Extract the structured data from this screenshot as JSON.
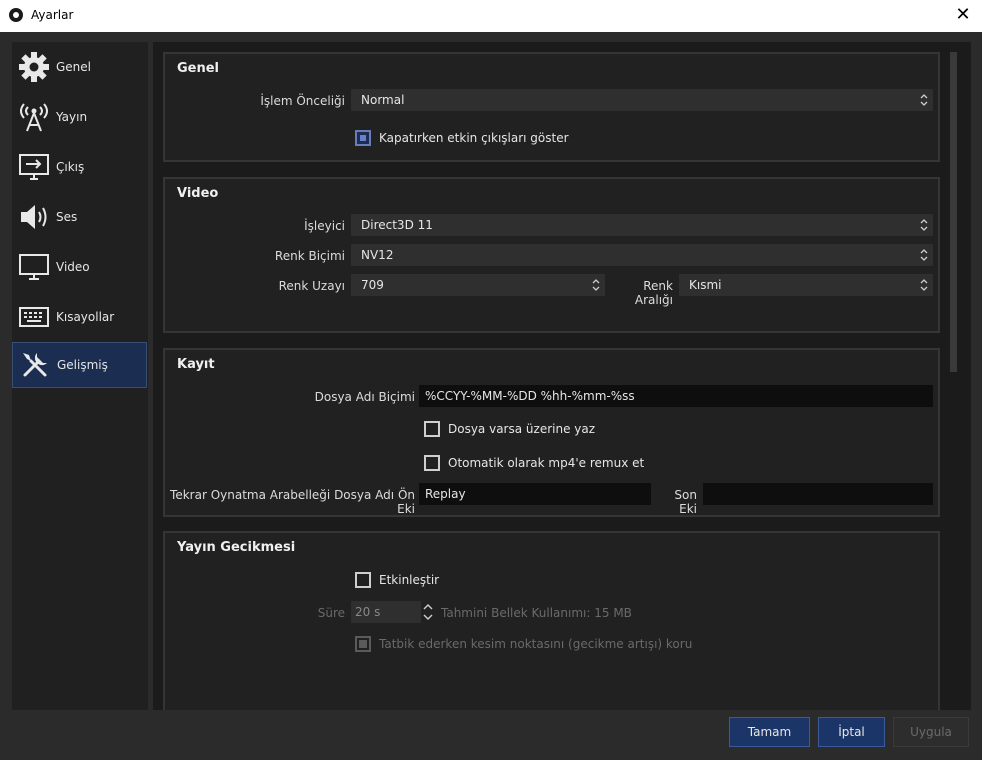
{
  "window": {
    "title": "Ayarlar",
    "close_glyph": "✕"
  },
  "sidebar": {
    "items": [
      {
        "label": "Genel",
        "icon": "gear-icon"
      },
      {
        "label": "Yayın",
        "icon": "broadcast-antenna-icon"
      },
      {
        "label": "Çıkış",
        "icon": "output-monitor-icon"
      },
      {
        "label": "Ses",
        "icon": "speaker-icon"
      },
      {
        "label": "Video",
        "icon": "monitor-icon"
      },
      {
        "label": "Kısayollar",
        "icon": "keyboard-icon"
      },
      {
        "label": "Gelişmiş",
        "icon": "tools-icon",
        "active": true
      }
    ]
  },
  "general": {
    "title": "Genel",
    "priority_label": "İşlem Önceliği",
    "priority_value": "Normal",
    "show_active_outputs_label": "Kapatırken etkin çıkışları göster",
    "show_active_outputs_checked": true
  },
  "video": {
    "title": "Video",
    "renderer_label": "İşleyici",
    "renderer_value": "Direct3D 11",
    "color_format_label": "Renk Biçimi",
    "color_format_value": "NV12",
    "color_space_label": "Renk Uzayı",
    "color_space_value": "709",
    "color_range_label": "Renk Aralığı",
    "color_range_value": "Kısmi"
  },
  "recording": {
    "title": "Kayıt",
    "filename_format_label": "Dosya Adı Biçimi",
    "filename_format_value": "%CCYY-%MM-%DD %hh-%mm-%ss",
    "overwrite_label": "Dosya varsa üzerine yaz",
    "overwrite_checked": false,
    "remux_label": "Otomatik olarak mp4'e remux et",
    "remux_checked": false,
    "replay_prefix_label": "Tekrar Oynatma Arabelleği Dosya Adı Ön Eki",
    "replay_prefix_value": "Replay",
    "suffix_label": "Son Eki",
    "suffix_value": ""
  },
  "stream_delay": {
    "title": "Yayın Gecikmesi",
    "enable_label": "Etkinleştir",
    "enable_checked": false,
    "duration_label": "Süre",
    "duration_value": "20 s",
    "memory_usage": "Tahmini Bellek Kullanımı: 15 MB",
    "preserve_label": "Tatbik ederken kesim noktasını (gecikme artışı) koru"
  },
  "buttons": {
    "ok": "Tamam",
    "cancel": "İptal",
    "apply": "Uygula"
  },
  "colors": {
    "accent": "#1c3568",
    "panel": "#212121",
    "background": "#2b2b2b"
  }
}
